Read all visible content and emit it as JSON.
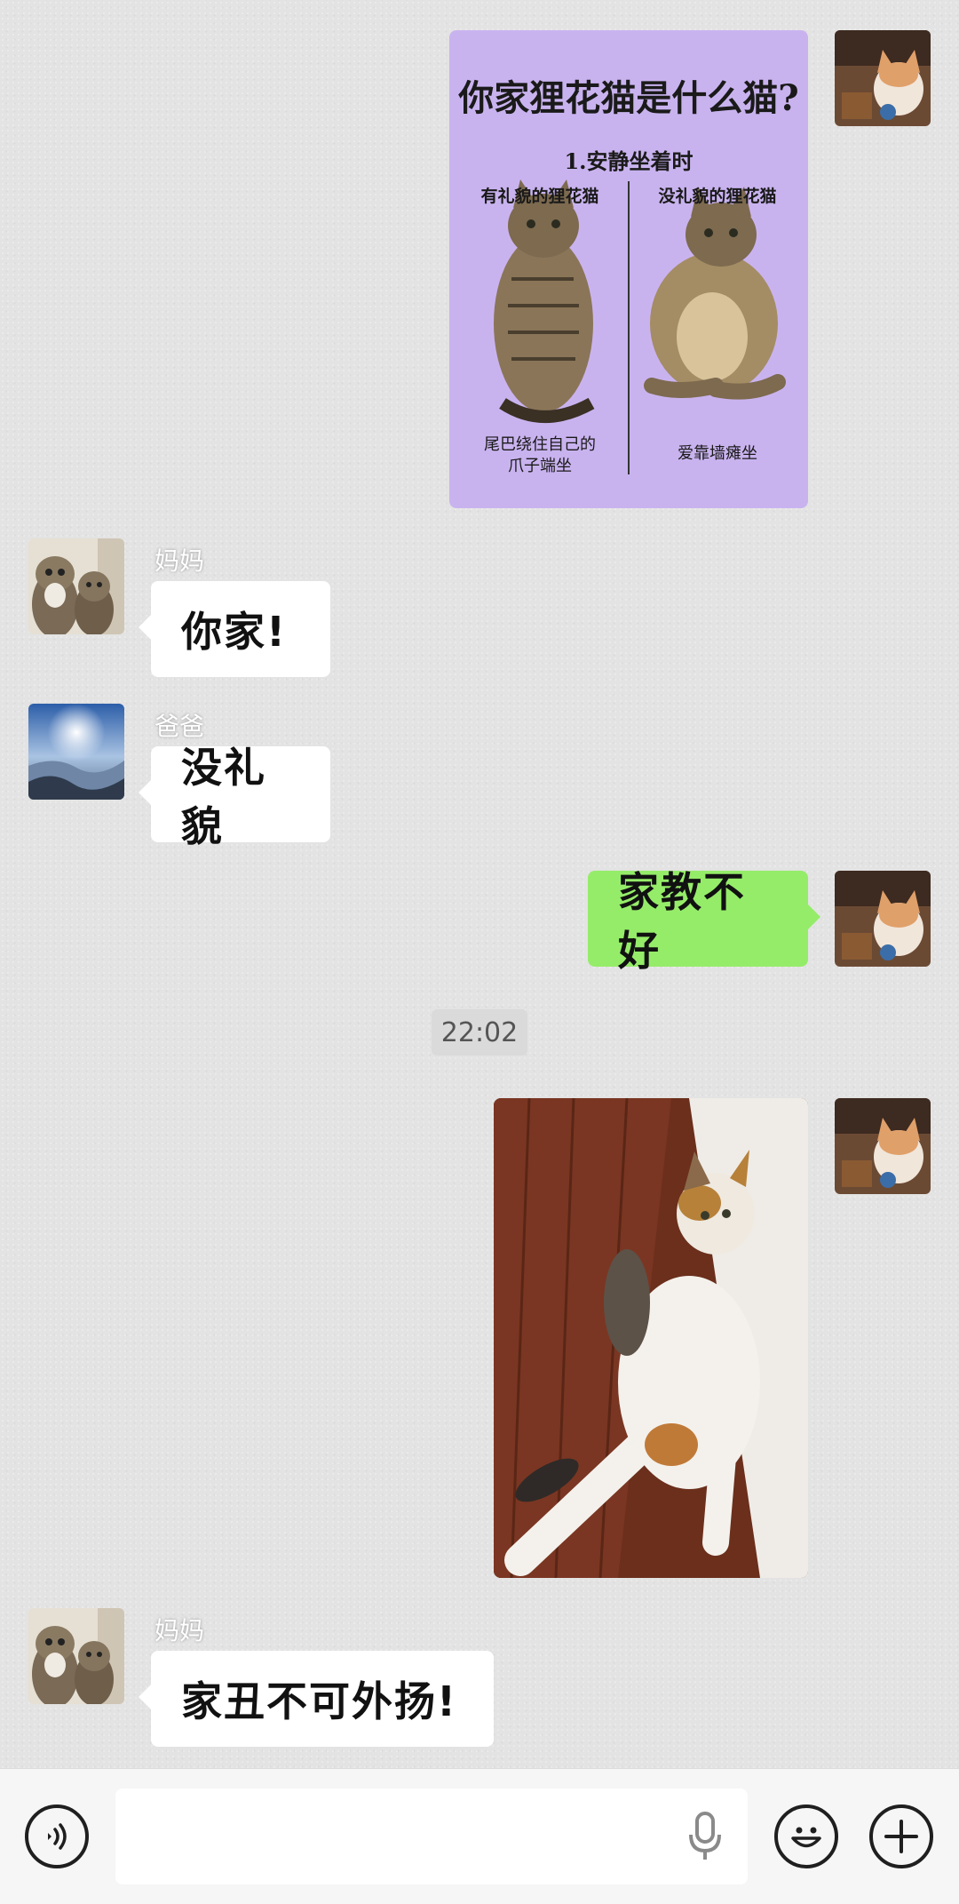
{
  "messages": {
    "meme": {
      "title": "你家狸花猫是什么猫?",
      "subtitle": "1.安静坐着时",
      "left_heading": "有礼貌的狸花猫",
      "right_heading": "没礼貌的狸花猫",
      "left_caption_line1": "尾巴绕住自己的",
      "left_caption_line2": "爪子端坐",
      "right_caption": "爱靠墙瘫坐"
    },
    "mom_1": {
      "sender": "妈妈",
      "text": "你家!"
    },
    "dad_1": {
      "sender": "爸爸",
      "text": "没礼貌"
    },
    "me_1": {
      "text": "家教不好"
    },
    "timestamp": "22:02",
    "mom_2": {
      "sender": "妈妈",
      "text": "家丑不可外扬!"
    }
  },
  "input_bar": {
    "voice_icon": "voice-toggle-icon",
    "mic_icon": "microphone-icon",
    "emoji_icon": "emoji-icon",
    "add_icon": "plus-icon",
    "value": ""
  },
  "colors": {
    "outgoing_bubble": "#95ec69",
    "incoming_bubble": "#ffffff",
    "meme_background": "#c9b3ef"
  }
}
